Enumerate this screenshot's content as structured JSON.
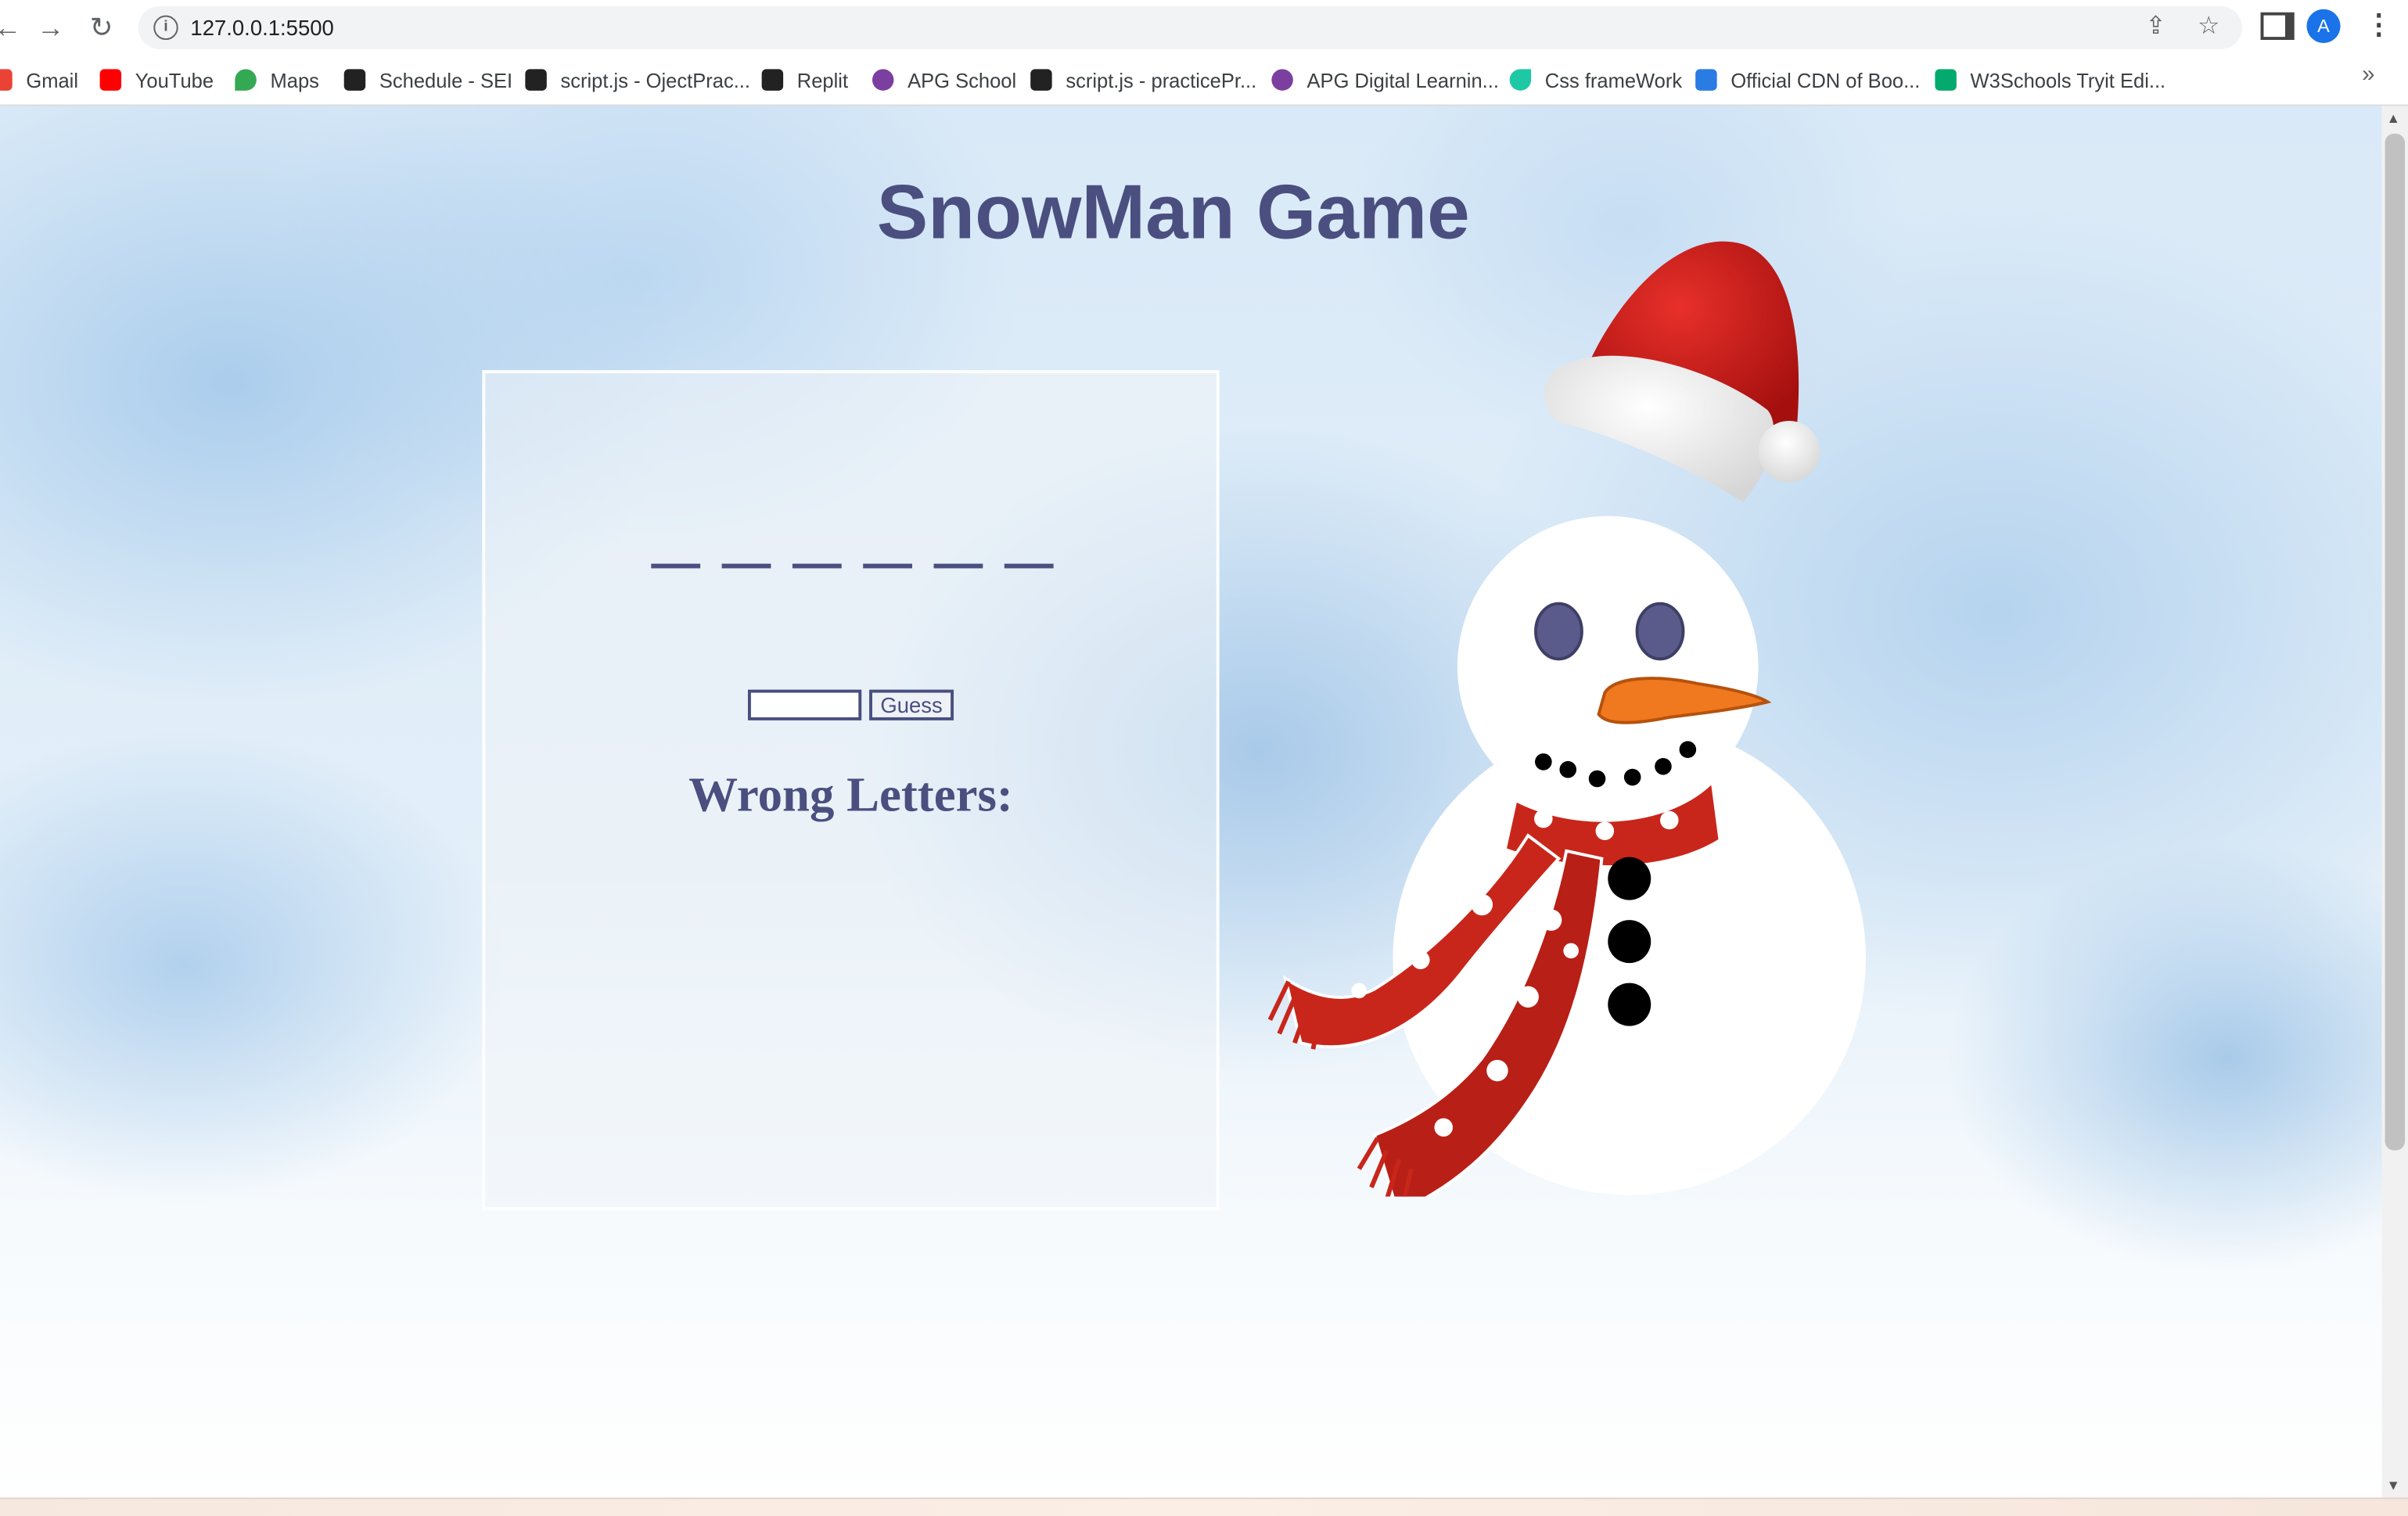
{
  "browser": {
    "url": "127.0.0.1:5500",
    "avatar_letter": "A",
    "bookmarks": [
      {
        "label": "Gmail",
        "icon": "gmail-icon",
        "color": "#ea4335"
      },
      {
        "label": "YouTube",
        "icon": "youtube-icon",
        "color": "#ff0000"
      },
      {
        "label": "Maps",
        "icon": "maps-icon",
        "color": "#34a853"
      },
      {
        "label": "Schedule - SEI",
        "icon": "ga-icon",
        "color": "#222222"
      },
      {
        "label": "script.js - OjectPrac...",
        "icon": "replit-icon",
        "color": "#222222"
      },
      {
        "label": "Replit",
        "icon": "replit-icon",
        "color": "#222222"
      },
      {
        "label": "APG School",
        "icon": "apg-icon",
        "color": "#7b3fa0"
      },
      {
        "label": "script.js - practicePr...",
        "icon": "replit-icon",
        "color": "#222222"
      },
      {
        "label": "APG Digital Learnin...",
        "icon": "apg-icon",
        "color": "#7b3fa0"
      },
      {
        "label": "Css frameWork",
        "icon": "css-icon",
        "color": "#1fc8a5"
      },
      {
        "label": "Official CDN of Boo...",
        "icon": "bootstrap-icon",
        "color": "#2a7be4"
      },
      {
        "label": "W3Schools Tryit Edi...",
        "icon": "w3schools-icon",
        "color": "#04aa6d"
      }
    ],
    "more_bookmarks": "»"
  },
  "page": {
    "title": "SnowMan Game",
    "blank_count": 6,
    "guess_button": "Guess",
    "guess_value": "",
    "wrong_letters_label": "Wrong Letters:",
    "accent_color": "#4a4f80"
  }
}
